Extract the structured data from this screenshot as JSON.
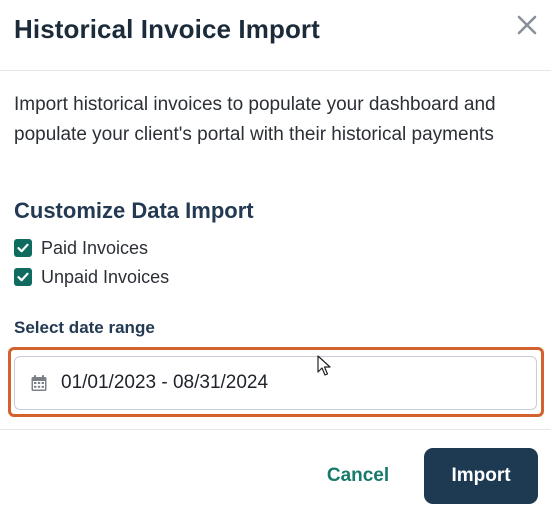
{
  "dialog": {
    "title": "Historical Invoice Import",
    "close_icon": "close-icon"
  },
  "body": {
    "description": "Import historical invoices to populate your dashboard and populate your client's portal with their historical payments",
    "section_title": "Customize Data Import",
    "options": [
      {
        "label": "Paid Invoices",
        "checked": true
      },
      {
        "label": "Unpaid Invoices",
        "checked": true
      }
    ],
    "date_range": {
      "label": "Select date range",
      "value": "01/01/2023 - 08/31/2024",
      "icon": "calendar-icon"
    }
  },
  "footer": {
    "cancel_label": "Cancel",
    "import_label": "Import"
  },
  "colors": {
    "title": "#1c2b3a",
    "accent_green": "#0f6b5f",
    "cancel_text": "#177a6a",
    "primary_button": "#1d3a52",
    "highlight_border": "#d4622f"
  }
}
